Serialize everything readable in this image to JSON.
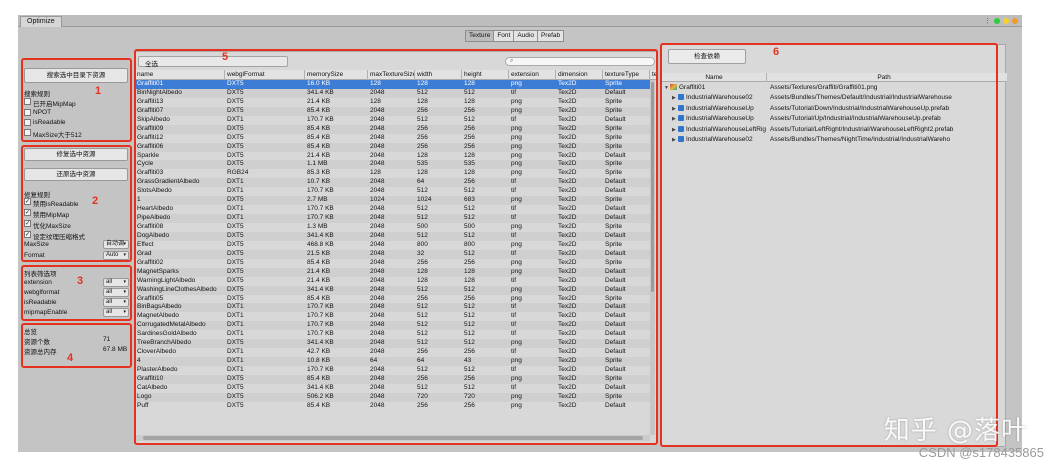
{
  "window": {
    "tab_label": "Optimize",
    "control_colors": [
      "#2ecc40",
      "#f5d130",
      "#f19a2b"
    ]
  },
  "top_tabs": [
    "Texture",
    "Font",
    "Audio",
    "Prefab"
  ],
  "region_labels": [
    "1",
    "2",
    "3",
    "4",
    "5",
    "6"
  ],
  "sidebar": {
    "search_button": "搜索选中目录下资源",
    "search_rules": {
      "title": "搜索规则",
      "items": [
        "已开启MipMap",
        "NPOT",
        "isReadable",
        "MaxSize大于512"
      ]
    },
    "fix_button": "修复选中资源",
    "restore_button": "还原选中资源",
    "fix_rules": {
      "title": "修复规则",
      "items": [
        "禁用isReadable",
        "禁用MipMap",
        "优化MaxSize",
        "设定纹理压缩格式"
      ],
      "maxsize_label": "MaxSize",
      "maxsize_value": "自动调",
      "format_label": "Format",
      "format_value": "Auto"
    },
    "filter": {
      "title": "列表筛选项",
      "rows": [
        {
          "label": "extension",
          "value": "all"
        },
        {
          "label": "webglformat",
          "value": "all"
        },
        {
          "label": "isReadable",
          "value": "all"
        },
        {
          "label": "mipmapEnable",
          "value": "all"
        }
      ]
    },
    "summary": {
      "title": "总览",
      "count_label": "资源个数",
      "count_value": "71",
      "memory_label": "资源总内存",
      "memory_value": "67.8 MB"
    }
  },
  "table": {
    "select_all": "全选",
    "search_placeholder": "",
    "columns": [
      "name",
      "webglFormat",
      "memorySize",
      "maxTextureSize",
      "width",
      "height",
      "extension",
      "dimension",
      "textureType",
      "te"
    ],
    "rows": [
      [
        "Graffiti01",
        "DXT5",
        "16.0 KB",
        "128",
        "128",
        "128",
        "png",
        "Tex2D",
        "Sprite"
      ],
      [
        "BinNightAlbedo",
        "DXT5",
        "341.4 KB",
        "2048",
        "512",
        "512",
        "tif",
        "Tex2D",
        "Default"
      ],
      [
        "Graffiti13",
        "DXT5",
        "21.4 KB",
        "128",
        "128",
        "128",
        "png",
        "Tex2D",
        "Sprite"
      ],
      [
        "Graffiti07",
        "DXT5",
        "85.4 KB",
        "2048",
        "256",
        "256",
        "png",
        "Tex2D",
        "Sprite"
      ],
      [
        "SkipAlbedo",
        "DXT1",
        "170.7 KB",
        "2048",
        "512",
        "512",
        "tif",
        "Tex2D",
        "Default"
      ],
      [
        "Graffiti09",
        "DXT5",
        "85.4 KB",
        "2048",
        "256",
        "256",
        "png",
        "Tex2D",
        "Sprite"
      ],
      [
        "Graffiti12",
        "DXT5",
        "85.4 KB",
        "2048",
        "256",
        "256",
        "png",
        "Tex2D",
        "Sprite"
      ],
      [
        "Graffiti06",
        "DXT5",
        "85.4 KB",
        "2048",
        "256",
        "256",
        "png",
        "Tex2D",
        "Sprite"
      ],
      [
        "Sparkle",
        "DXT5",
        "21.4 KB",
        "2048",
        "128",
        "128",
        "png",
        "Tex2D",
        "Default"
      ],
      [
        "Cycle",
        "DXT5",
        "1.1 MB",
        "2048",
        "535",
        "535",
        "png",
        "Tex2D",
        "Sprite"
      ],
      [
        "Graffiti03",
        "RGB24",
        "85.3 KB",
        "128",
        "128",
        "128",
        "png",
        "Tex2D",
        "Sprite"
      ],
      [
        "GrassGradientAlbedo",
        "DXT1",
        "10.7 KB",
        "2048",
        "64",
        "256",
        "tif",
        "Tex2D",
        "Default"
      ],
      [
        "SlotsAlbedo",
        "DXT1",
        "170.7 KB",
        "2048",
        "512",
        "512",
        "tif",
        "Tex2D",
        "Default"
      ],
      [
        "1",
        "DXT5",
        "2.7 MB",
        "1024",
        "1024",
        "683",
        "png",
        "Tex2D",
        "Sprite"
      ],
      [
        "HeartAlbedo",
        "DXT1",
        "170.7 KB",
        "2048",
        "512",
        "512",
        "tif",
        "Tex2D",
        "Default"
      ],
      [
        "PipeAlbedo",
        "DXT1",
        "170.7 KB",
        "2048",
        "512",
        "512",
        "tif",
        "Tex2D",
        "Default"
      ],
      [
        "Graffiti08",
        "DXT5",
        "1.3 MB",
        "2048",
        "500",
        "500",
        "png",
        "Tex2D",
        "Sprite"
      ],
      [
        "DogAlbedo",
        "DXT5",
        "341.4 KB",
        "2048",
        "512",
        "512",
        "tif",
        "Tex2D",
        "Default"
      ],
      [
        "Effect",
        "DXT5",
        "468.8 KB",
        "2048",
        "800",
        "800",
        "png",
        "Tex2D",
        "Sprite"
      ],
      [
        "Grad",
        "DXT5",
        "21.5 KB",
        "2048",
        "32",
        "512",
        "tif",
        "Tex2D",
        "Default"
      ],
      [
        "Graffiti02",
        "DXT5",
        "85.4 KB",
        "2048",
        "256",
        "256",
        "png",
        "Tex2D",
        "Sprite"
      ],
      [
        "MagnetSparks",
        "DXT5",
        "21.4 KB",
        "2048",
        "128",
        "128",
        "png",
        "Tex2D",
        "Default"
      ],
      [
        "WarningLightAlbedo",
        "DXT5",
        "21.4 KB",
        "2048",
        "128",
        "128",
        "tif",
        "Tex2D",
        "Default"
      ],
      [
        "WashingLineClothesAlbedo",
        "DXT5",
        "341.4 KB",
        "2048",
        "512",
        "512",
        "png",
        "Tex2D",
        "Default"
      ],
      [
        "Graffiti05",
        "DXT5",
        "85.4 KB",
        "2048",
        "256",
        "256",
        "png",
        "Tex2D",
        "Sprite"
      ],
      [
        "BinBagsAlbedo",
        "DXT1",
        "170.7 KB",
        "2048",
        "512",
        "512",
        "tif",
        "Tex2D",
        "Default"
      ],
      [
        "MagnetAlbedo",
        "DXT1",
        "170.7 KB",
        "2048",
        "512",
        "512",
        "tif",
        "Tex2D",
        "Default"
      ],
      [
        "CorrugatedMetalAlbedo",
        "DXT1",
        "170.7 KB",
        "2048",
        "512",
        "512",
        "tif",
        "Tex2D",
        "Default"
      ],
      [
        "SardinesGoldAlbedo",
        "DXT1",
        "170.7 KB",
        "2048",
        "512",
        "512",
        "tif",
        "Tex2D",
        "Default"
      ],
      [
        "TreeBranchAlbedo",
        "DXT5",
        "341.4 KB",
        "2048",
        "512",
        "512",
        "png",
        "Tex2D",
        "Default"
      ],
      [
        "CloverAlbedo",
        "DXT1",
        "42.7 KB",
        "2048",
        "256",
        "256",
        "tif",
        "Tex2D",
        "Default"
      ],
      [
        "4",
        "DXT1",
        "10.8 KB",
        "64",
        "64",
        "43",
        "png",
        "Tex2D",
        "Sprite"
      ],
      [
        "PlasterAlbedo",
        "DXT1",
        "170.7 KB",
        "2048",
        "512",
        "512",
        "tif",
        "Tex2D",
        "Default"
      ],
      [
        "Graffiti10",
        "DXT5",
        "85.4 KB",
        "2048",
        "256",
        "256",
        "png",
        "Tex2D",
        "Sprite"
      ],
      [
        "CatAlbedo",
        "DXT5",
        "341.4 KB",
        "2048",
        "512",
        "512",
        "tif",
        "Tex2D",
        "Default"
      ],
      [
        "Logo",
        "DXT5",
        "506.2 KB",
        "2048",
        "720",
        "720",
        "png",
        "Tex2D",
        "Sprite"
      ],
      [
        "Puff",
        "DXT5",
        "85.4 KB",
        "2048",
        "256",
        "256",
        "png",
        "Tex2D",
        "Default"
      ]
    ]
  },
  "deps": {
    "check_button": "检查依赖",
    "col_name": "Name",
    "col_path": "Path",
    "root": {
      "name": "Graffiti01",
      "path": "Assets/Textures/Graffiti/Graffiti01.png"
    },
    "children": [
      {
        "name": "IndustrialWarehouse02",
        "path": "Assets/Bundles/Themes/Default/Industrial/IndustrialWarehouse"
      },
      {
        "name": "IndustrialWarehouseUp",
        "path": "Assets/Tutorial/Down/Industrial/IndustrialWarehouseUp.prefab"
      },
      {
        "name": "IndustrialWarehouseUp",
        "path": "Assets/Tutorial/Up/Industrial/IndustrialWarehouseUp.prefab"
      },
      {
        "name": "IndustrialWarehouseLeftRig",
        "path": "Assets/Tutorial/LeftRight/Industrial/WarehouseLeftRight2.prefab"
      },
      {
        "name": "IndustrialWarehouse02",
        "path": "Assets/Bundles/Themes/NightTime/Industrial/IndustrialWareho"
      }
    ]
  },
  "watermark": {
    "main": "知乎 @落叶",
    "sub": "CSDN @s178435865"
  }
}
